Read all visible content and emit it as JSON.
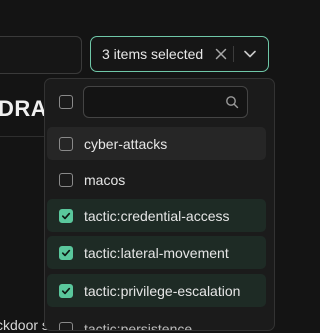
{
  "background": {
    "heading_fragment": "DRA",
    "bottom_text_fragment": "ckdoor simulator the FINAL DRAFT"
  },
  "select": {
    "value": "3 items selected",
    "clear_icon": "close-icon",
    "toggle_icon": "chevron-down-icon",
    "accent": "#6fc7a8"
  },
  "dropdown": {
    "search": {
      "value": "",
      "placeholder": ""
    },
    "select_all_checked": false,
    "options": [
      {
        "label": "cyber-attacks",
        "checked": false
      },
      {
        "label": "macos",
        "checked": false
      },
      {
        "label": "tactic:credential-access",
        "checked": true
      },
      {
        "label": "tactic:lateral-movement",
        "checked": true
      },
      {
        "label": "tactic:privilege-escalation",
        "checked": true
      },
      {
        "label": "tactic:persistence",
        "checked": false
      }
    ],
    "checked_color": "#5ac79c"
  }
}
